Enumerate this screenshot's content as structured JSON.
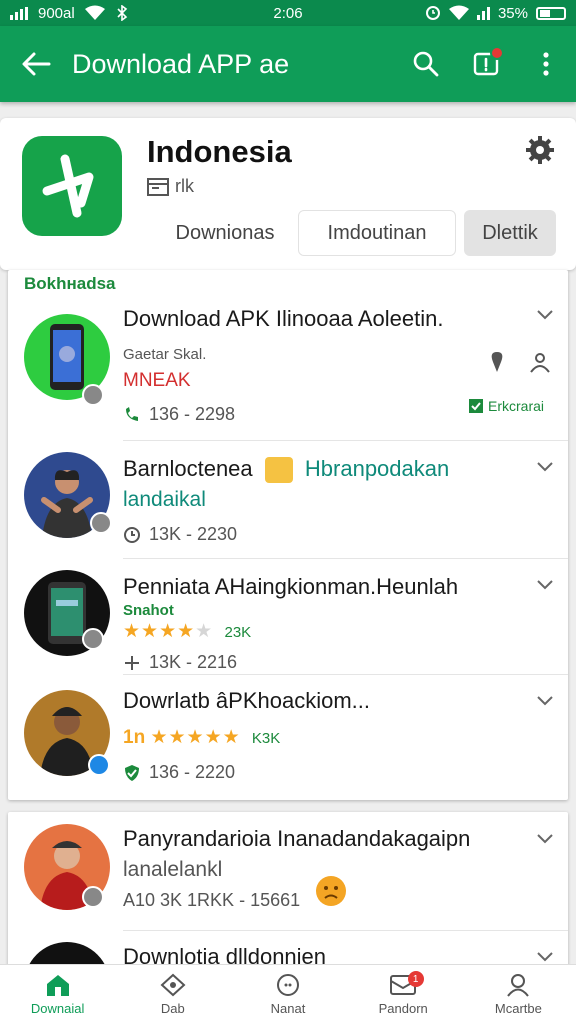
{
  "status_bar": {
    "carrier": "900al",
    "time": "2:06",
    "battery": "35%"
  },
  "app_bar": {
    "title": "Download APP ae",
    "icons": [
      "back-arrow-icon",
      "search-icon",
      "notification-icon",
      "more-vert-icon"
    ]
  },
  "app_header": {
    "name": "Indonesia",
    "meta": "rlk",
    "tabs": [
      "Downionas",
      "Imdoutinan",
      "Dlettik"
    ]
  },
  "section": {
    "label": "Bokhнadsa"
  },
  "items": [
    {
      "title": "Download APK Ilinooaa Aoleetin.",
      "subtitle": "Gaetar Skal.",
      "tag": "MNEAK",
      "stats": "136 - 2298",
      "badge": "Erkcrarai"
    },
    {
      "title": "Barnloctenea",
      "title_accent": "Hbranpodakan",
      "subtitle": "landaikal",
      "stats": "13K - 2230"
    },
    {
      "title": "Penniata AHaingkionman.Heunlah",
      "subtitle": "Snahot",
      "rating_text": "23K",
      "rating": 3.5,
      "stats": "13K - 2216"
    },
    {
      "title": "Dowrlatb âPKhoackiom...",
      "rating_prefix": "1n",
      "rating_text": "K3K",
      "rating": 5,
      "stats": "136 - 2220"
    },
    {
      "title": "Panyrandarioia Inanadandakagaipn",
      "subtitle": "lanalelankl",
      "stats": "A10 3K 1RKK - 15661"
    },
    {
      "title": "Downlotia dlldonnien"
    }
  ],
  "bottom_nav": [
    {
      "label": "Downaial",
      "icon": "home-icon"
    },
    {
      "label": "Dab",
      "icon": "tag-icon"
    },
    {
      "label": "Nanat",
      "icon": "chat-icon"
    },
    {
      "label": "Pandorn",
      "icon": "inbox-icon",
      "badge": "1"
    },
    {
      "label": "Mcartbe",
      "icon": "profile-icon"
    }
  ],
  "colors": {
    "primary": "#0f9d58",
    "status_bar": "#0b8a4d",
    "accent_green": "#1c8a3c",
    "star": "#f5a623",
    "alert_red": "#e53935"
  }
}
